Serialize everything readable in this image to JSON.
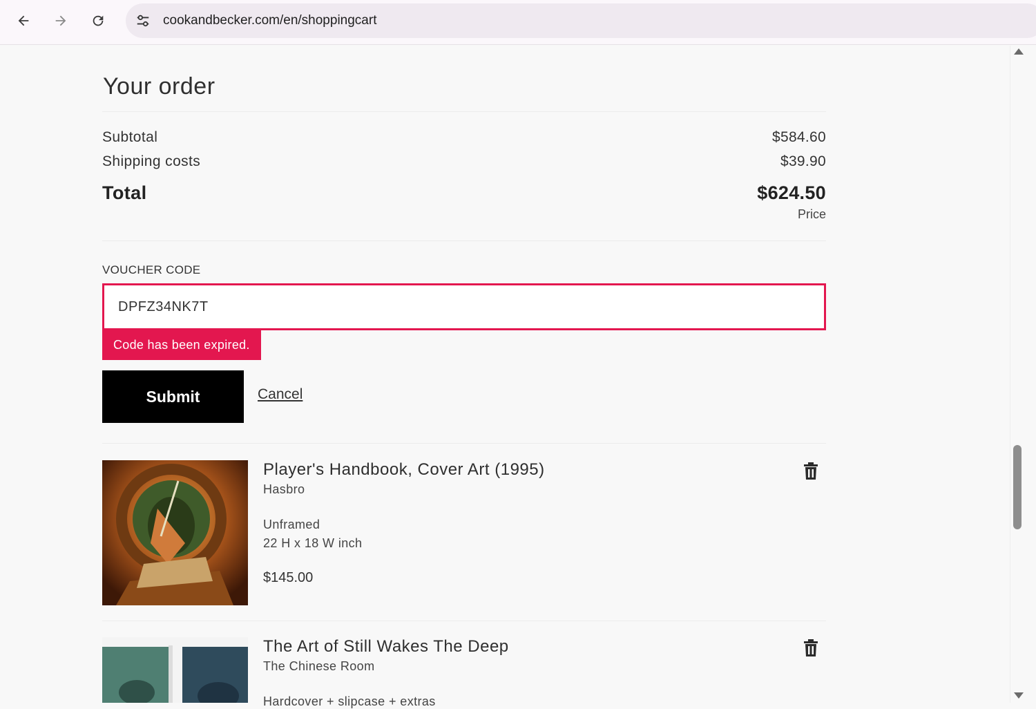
{
  "browser": {
    "url": "cookandbecker.com/en/shoppingcart",
    "back_icon": "arrow-left-icon",
    "forward_icon": "arrow-right-icon",
    "reload_icon": "reload-icon",
    "site_info_icon": "tune-icon"
  },
  "order": {
    "title": "Your order",
    "subtotal_label": "Subtotal",
    "subtotal_value": "$584.60",
    "shipping_label": "Shipping costs",
    "shipping_value": "$39.90",
    "total_label": "Total",
    "total_value": "$624.50",
    "price_note": "Price"
  },
  "voucher": {
    "label": "VOUCHER CODE",
    "value": "DPFZ34NK7T",
    "error": "Code has been expired.",
    "submit_label": "Submit",
    "cancel_label": "Cancel"
  },
  "items": [
    {
      "title": "Player's Handbook, Cover Art (1995)",
      "publisher": "Hasbro",
      "frame": "Unframed",
      "size": "22 H x 18 W inch",
      "price": "$145.00"
    },
    {
      "title": "The Art of Still Wakes The Deep",
      "publisher": "The Chinese Room",
      "format": "Hardcover + slipcase + extras"
    }
  ],
  "colors": {
    "accent": "#e3174f",
    "button": "#000000",
    "background": "#f8f8f8"
  }
}
